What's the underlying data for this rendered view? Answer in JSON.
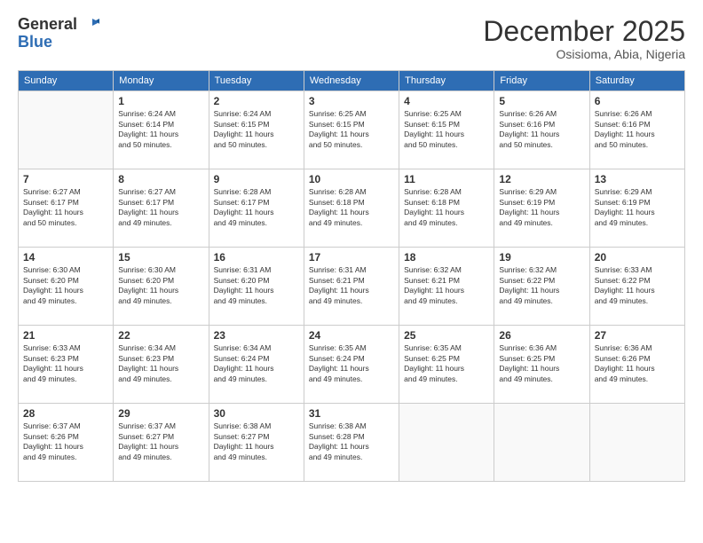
{
  "header": {
    "logo_line1": "General",
    "logo_line2": "Blue",
    "month": "December 2025",
    "location": "Osisioma, Abia, Nigeria"
  },
  "weekdays": [
    "Sunday",
    "Monday",
    "Tuesday",
    "Wednesday",
    "Thursday",
    "Friday",
    "Saturday"
  ],
  "weeks": [
    [
      {
        "day": "",
        "info": ""
      },
      {
        "day": "1",
        "info": "Sunrise: 6:24 AM\nSunset: 6:14 PM\nDaylight: 11 hours\nand 50 minutes."
      },
      {
        "day": "2",
        "info": "Sunrise: 6:24 AM\nSunset: 6:15 PM\nDaylight: 11 hours\nand 50 minutes."
      },
      {
        "day": "3",
        "info": "Sunrise: 6:25 AM\nSunset: 6:15 PM\nDaylight: 11 hours\nand 50 minutes."
      },
      {
        "day": "4",
        "info": "Sunrise: 6:25 AM\nSunset: 6:15 PM\nDaylight: 11 hours\nand 50 minutes."
      },
      {
        "day": "5",
        "info": "Sunrise: 6:26 AM\nSunset: 6:16 PM\nDaylight: 11 hours\nand 50 minutes."
      },
      {
        "day": "6",
        "info": "Sunrise: 6:26 AM\nSunset: 6:16 PM\nDaylight: 11 hours\nand 50 minutes."
      }
    ],
    [
      {
        "day": "7",
        "info": "Sunrise: 6:27 AM\nSunset: 6:17 PM\nDaylight: 11 hours\nand 50 minutes."
      },
      {
        "day": "8",
        "info": "Sunrise: 6:27 AM\nSunset: 6:17 PM\nDaylight: 11 hours\nand 49 minutes."
      },
      {
        "day": "9",
        "info": "Sunrise: 6:28 AM\nSunset: 6:17 PM\nDaylight: 11 hours\nand 49 minutes."
      },
      {
        "day": "10",
        "info": "Sunrise: 6:28 AM\nSunset: 6:18 PM\nDaylight: 11 hours\nand 49 minutes."
      },
      {
        "day": "11",
        "info": "Sunrise: 6:28 AM\nSunset: 6:18 PM\nDaylight: 11 hours\nand 49 minutes."
      },
      {
        "day": "12",
        "info": "Sunrise: 6:29 AM\nSunset: 6:19 PM\nDaylight: 11 hours\nand 49 minutes."
      },
      {
        "day": "13",
        "info": "Sunrise: 6:29 AM\nSunset: 6:19 PM\nDaylight: 11 hours\nand 49 minutes."
      }
    ],
    [
      {
        "day": "14",
        "info": "Sunrise: 6:30 AM\nSunset: 6:20 PM\nDaylight: 11 hours\nand 49 minutes."
      },
      {
        "day": "15",
        "info": "Sunrise: 6:30 AM\nSunset: 6:20 PM\nDaylight: 11 hours\nand 49 minutes."
      },
      {
        "day": "16",
        "info": "Sunrise: 6:31 AM\nSunset: 6:20 PM\nDaylight: 11 hours\nand 49 minutes."
      },
      {
        "day": "17",
        "info": "Sunrise: 6:31 AM\nSunset: 6:21 PM\nDaylight: 11 hours\nand 49 minutes."
      },
      {
        "day": "18",
        "info": "Sunrise: 6:32 AM\nSunset: 6:21 PM\nDaylight: 11 hours\nand 49 minutes."
      },
      {
        "day": "19",
        "info": "Sunrise: 6:32 AM\nSunset: 6:22 PM\nDaylight: 11 hours\nand 49 minutes."
      },
      {
        "day": "20",
        "info": "Sunrise: 6:33 AM\nSunset: 6:22 PM\nDaylight: 11 hours\nand 49 minutes."
      }
    ],
    [
      {
        "day": "21",
        "info": "Sunrise: 6:33 AM\nSunset: 6:23 PM\nDaylight: 11 hours\nand 49 minutes."
      },
      {
        "day": "22",
        "info": "Sunrise: 6:34 AM\nSunset: 6:23 PM\nDaylight: 11 hours\nand 49 minutes."
      },
      {
        "day": "23",
        "info": "Sunrise: 6:34 AM\nSunset: 6:24 PM\nDaylight: 11 hours\nand 49 minutes."
      },
      {
        "day": "24",
        "info": "Sunrise: 6:35 AM\nSunset: 6:24 PM\nDaylight: 11 hours\nand 49 minutes."
      },
      {
        "day": "25",
        "info": "Sunrise: 6:35 AM\nSunset: 6:25 PM\nDaylight: 11 hours\nand 49 minutes."
      },
      {
        "day": "26",
        "info": "Sunrise: 6:36 AM\nSunset: 6:25 PM\nDaylight: 11 hours\nand 49 minutes."
      },
      {
        "day": "27",
        "info": "Sunrise: 6:36 AM\nSunset: 6:26 PM\nDaylight: 11 hours\nand 49 minutes."
      }
    ],
    [
      {
        "day": "28",
        "info": "Sunrise: 6:37 AM\nSunset: 6:26 PM\nDaylight: 11 hours\nand 49 minutes."
      },
      {
        "day": "29",
        "info": "Sunrise: 6:37 AM\nSunset: 6:27 PM\nDaylight: 11 hours\nand 49 minutes."
      },
      {
        "day": "30",
        "info": "Sunrise: 6:38 AM\nSunset: 6:27 PM\nDaylight: 11 hours\nand 49 minutes."
      },
      {
        "day": "31",
        "info": "Sunrise: 6:38 AM\nSunset: 6:28 PM\nDaylight: 11 hours\nand 49 minutes."
      },
      {
        "day": "",
        "info": ""
      },
      {
        "day": "",
        "info": ""
      },
      {
        "day": "",
        "info": ""
      }
    ]
  ]
}
